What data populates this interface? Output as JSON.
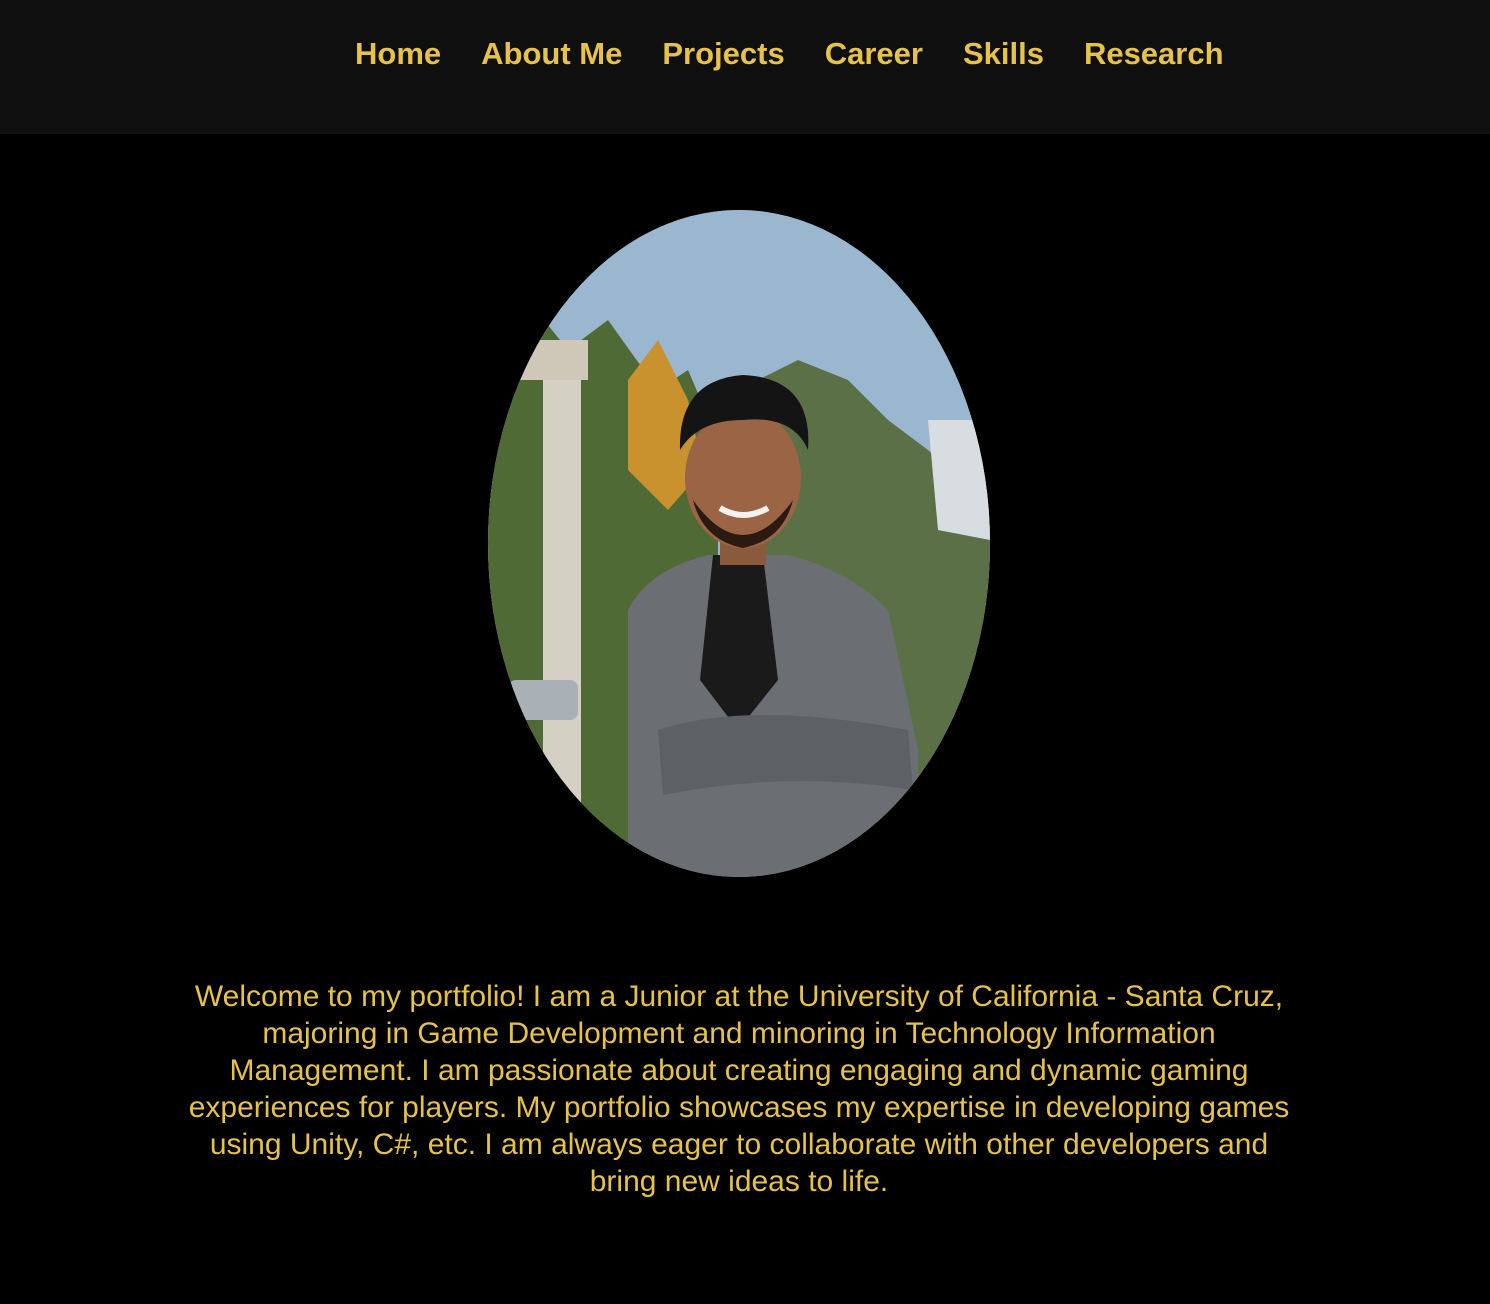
{
  "nav": {
    "items": [
      {
        "label": "Home"
      },
      {
        "label": "About Me"
      },
      {
        "label": "Projects"
      },
      {
        "label": "Career"
      },
      {
        "label": "Skills"
      },
      {
        "label": "Research"
      }
    ]
  },
  "hero": {
    "photo_icon": "profile-photo"
  },
  "intro": {
    "text": "Welcome to my portfolio! I am a Junior at the University of California - Santa Cruz, majoring in Game Development and minoring in Technology Information Management. I am passionate about creating engaging and dynamic gaming experiences for players. My portfolio showcases my expertise in developing games using Unity, C#, etc. I am always eager to collaborate with other developers and bring new ideas to life."
  },
  "colors": {
    "background": "#000000",
    "navbar_background": "#0f0f0f",
    "accent_text": "#e6c24a"
  }
}
